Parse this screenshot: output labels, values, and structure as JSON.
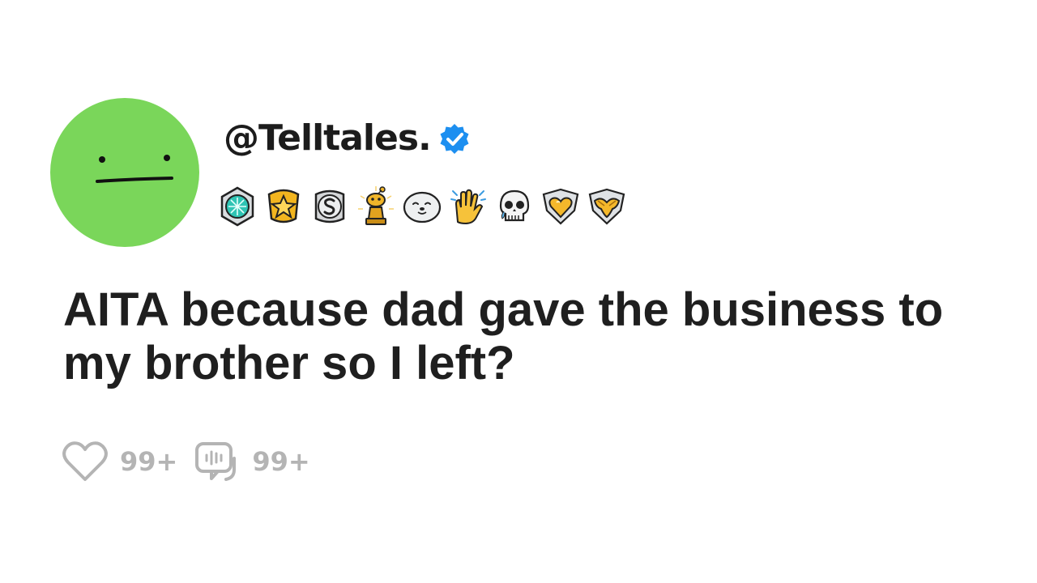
{
  "post": {
    "username": "@Telltales.",
    "verified": true,
    "title": "AITA because dad gave the business to my brother so I left?",
    "awards": [
      "diamond-gem-award-icon",
      "gold-star-award-icon",
      "silver-coin-award-icon",
      "golden-snoo-trophy-icon",
      "seal-award-icon",
      "clapping-hands-award-icon",
      "laughing-skull-award-icon",
      "gold-heart-shield-award-icon",
      "gold-wings-shield-award-icon"
    ]
  },
  "stats": {
    "likes": "99+",
    "comments": "99+"
  },
  "colors": {
    "avatar": "#7ad65a",
    "verified": "#1d8ff0",
    "title_text": "#1f1f1f",
    "stat_gray": "#b4b4b4"
  }
}
